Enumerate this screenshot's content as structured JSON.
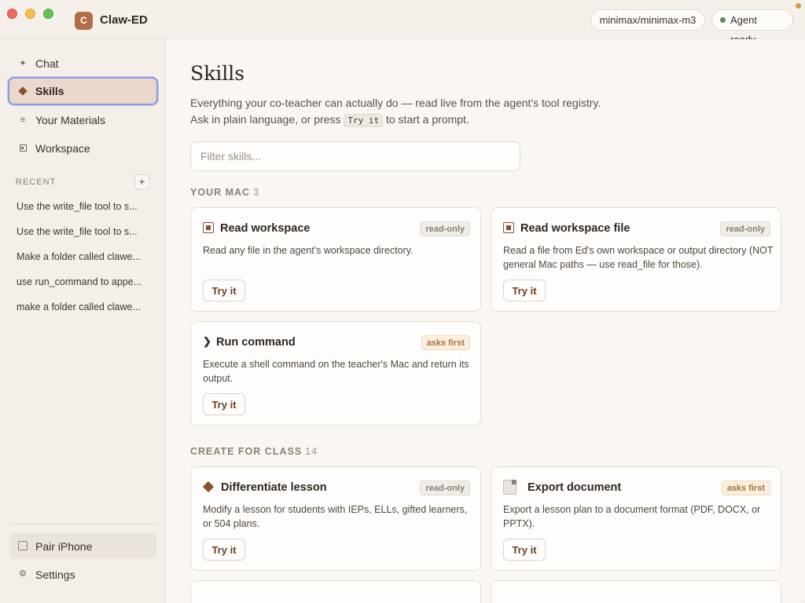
{
  "window": {
    "app_initial": "C",
    "app_title": "Claw-ED",
    "model_label": "minimax/minimax-m3",
    "status_label": "Agent ready"
  },
  "sidebar": {
    "nav": [
      {
        "label": "Chat",
        "icon": "sparkle-icon"
      },
      {
        "label": "Skills",
        "icon": "diamond-icon"
      },
      {
        "label": "Your Materials",
        "icon": "list-icon"
      },
      {
        "label": "Workspace",
        "icon": "workspace-icon"
      }
    ],
    "recent_heading": "RECENT",
    "recent_add": "+",
    "recent": [
      "Use the write_file tool to s...",
      "Use the write_file tool to s...",
      "Make a folder called clawe...",
      "use run_command to appe...",
      "make a folder called clawe..."
    ],
    "pair_label": "Pair iPhone",
    "settings_label": "Settings"
  },
  "main": {
    "title": "Skills",
    "desc_line1": "Everything your co-teacher can actually do — read live from the agent's tool registry.",
    "desc_line2_pre": "Ask in plain language, or press",
    "desc_line2_code": "Try it",
    "desc_line2_post": "to start a prompt.",
    "filter_placeholder": "Filter skills...",
    "filter_value": "",
    "sections": [
      {
        "name": "YOUR MAC",
        "count": "3",
        "cards": [
          {
            "title": "Read workspace",
            "badge": "read-only",
            "desc": "Read any file in the agent's workspace directory.",
            "button": "Try it"
          },
          {
            "title": "Read workspace file",
            "badge": "read-only",
            "desc": "Read a file from Ed's own workspace or output directory (NOT general Mac paths — use read_file for those).",
            "button": "Try it"
          },
          {
            "title": "Run command",
            "badge": "asks first",
            "desc": "Execute a shell command on the teacher's Mac and return its output.",
            "button": "Try it"
          }
        ]
      },
      {
        "name": "CREATE FOR CLASS",
        "count": "14",
        "cards": [
          {
            "title": "Differentiate lesson",
            "badge": "read-only",
            "desc": "Modify a lesson for students with IEPs, ELLs, gifted learners, or 504 plans.",
            "button": "Try it"
          },
          {
            "title": "Export document",
            "badge": "asks first",
            "desc": "Export a lesson plan to a document format (PDF, DOCX, or PPTX).",
            "button": "Try it"
          }
        ]
      }
    ]
  },
  "colors": {
    "accent": "#8a4f30",
    "active_nav_bg": "#ead8cd",
    "focus_ring": "#8e99e0",
    "status_ready": "#5c8a64"
  }
}
